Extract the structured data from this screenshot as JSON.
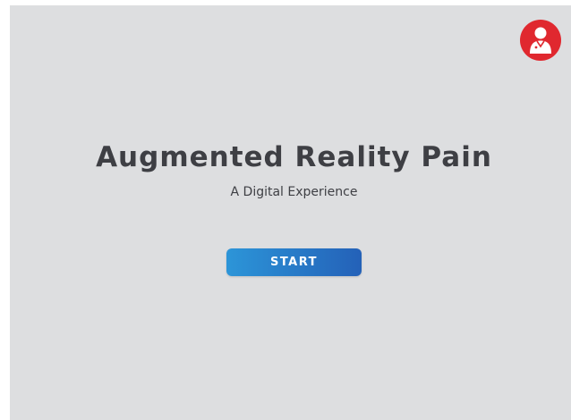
{
  "app": {
    "title": "Augmented Reality Pain",
    "subtitle": "A Digital Experience"
  },
  "actions": {
    "start_label": "START"
  },
  "profile": {
    "icon": "doctor-avatar-icon"
  },
  "colors": {
    "background": "#dddee0",
    "title_text": "#3e3f44",
    "profile_badge": "#e0282f",
    "button_gradient_start": "#2c95d8",
    "button_gradient_end": "#2461b8",
    "button_text": "#ffffff"
  }
}
